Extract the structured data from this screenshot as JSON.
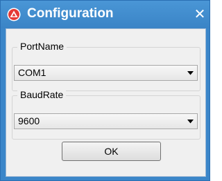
{
  "window": {
    "title": "Configuration",
    "close_label": "✕"
  },
  "port_group": {
    "label": "PortName",
    "selected_value": "COM1"
  },
  "baud_group": {
    "label": "BaudRate",
    "selected_value": "9600"
  },
  "ok_button": {
    "label": "OK"
  },
  "colors": {
    "titlebar": "#3b86c9",
    "client_bg": "#f0f0f0",
    "app_icon_red": "#e53935"
  }
}
